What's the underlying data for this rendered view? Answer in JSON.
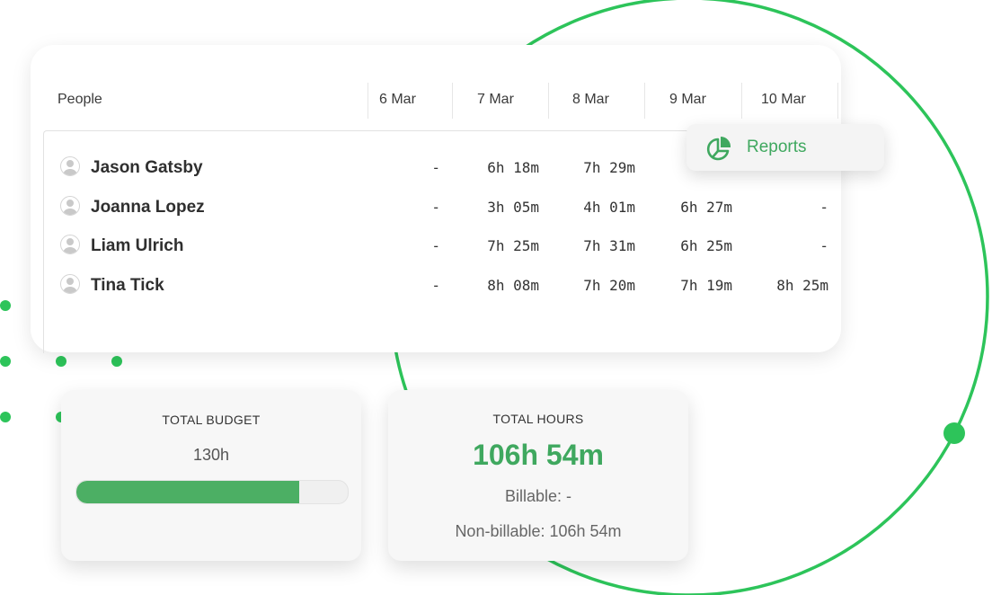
{
  "colors": {
    "accent": "#3fa85f",
    "ring": "#2dc45a"
  },
  "timesheet": {
    "columns": [
      "People",
      "6 Mar",
      "7 Mar",
      "8 Mar",
      "9 Mar",
      "10 Mar"
    ],
    "rows": [
      {
        "name": "Jason Gatsby",
        "cells": [
          "-",
          "6h 18m",
          "7h 29m",
          "",
          ""
        ]
      },
      {
        "name": "Joanna Lopez",
        "cells": [
          "-",
          "3h 05m",
          "4h 01m",
          "6h 27m",
          "-"
        ]
      },
      {
        "name": "Liam Ulrich",
        "cells": [
          "-",
          "7h 25m",
          "7h 31m",
          "6h 25m",
          "-"
        ]
      },
      {
        "name": "Tina Tick",
        "cells": [
          "-",
          "8h 08m",
          "7h 20m",
          "7h 19m",
          "8h 25m"
        ]
      }
    ]
  },
  "reports": {
    "label": "Reports",
    "icon": "pie-chart-icon"
  },
  "budget": {
    "title": "TOTAL BUDGET",
    "value": "130h",
    "progress_percent": 82
  },
  "hours": {
    "title": "TOTAL HOURS",
    "value": "106h 54m",
    "billable": "Billable: -",
    "non_billable": "Non-billable: 106h 54m"
  }
}
